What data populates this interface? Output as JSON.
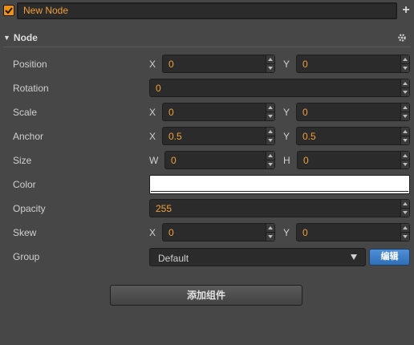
{
  "node": {
    "name": "New Node",
    "active": true
  },
  "section": {
    "title": "Node"
  },
  "properties": {
    "position": {
      "label": "Position",
      "x_axis": "X",
      "y_axis": "Y",
      "x": "0",
      "y": "0"
    },
    "rotation": {
      "label": "Rotation",
      "value": "0"
    },
    "scale": {
      "label": "Scale",
      "x_axis": "X",
      "y_axis": "Y",
      "x": "0",
      "y": "0"
    },
    "anchor": {
      "label": "Anchor",
      "x_axis": "X",
      "y_axis": "Y",
      "x": "0.5",
      "y": "0.5"
    },
    "size": {
      "label": "Size",
      "w_axis": "W",
      "h_axis": "H",
      "w": "0",
      "h": "0"
    },
    "color": {
      "label": "Color",
      "value": "#ffffff"
    },
    "opacity": {
      "label": "Opacity",
      "value": "255"
    },
    "skew": {
      "label": "Skew",
      "x_axis": "X",
      "y_axis": "Y",
      "x": "0",
      "y": "0"
    },
    "group": {
      "label": "Group",
      "selected": "Default",
      "edit_label": "编辑"
    }
  },
  "add_component_label": "添加组件",
  "icons": {
    "add": "plus-icon",
    "settings": "gear-icon",
    "collapse": "triangle-down-icon",
    "check": "check-icon"
  },
  "colors": {
    "accent": "#f2920c",
    "value_text": "#f2a13a",
    "edit_button": "#3f7fc7",
    "background": "#474747"
  }
}
